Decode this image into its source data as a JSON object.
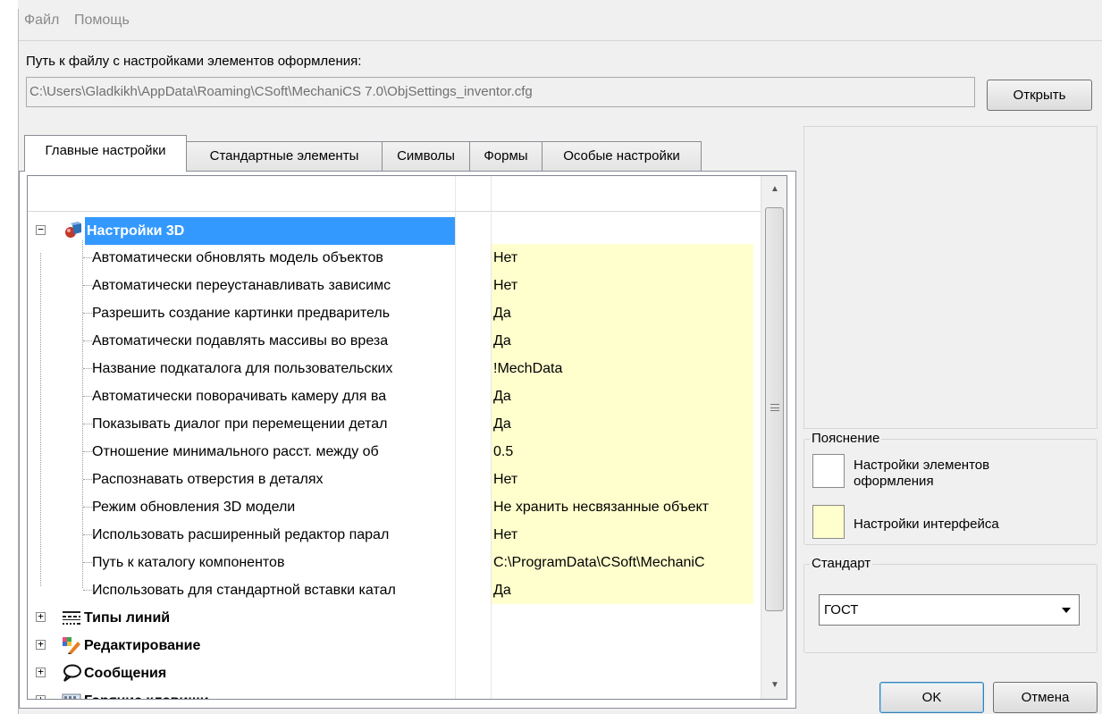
{
  "menu": {
    "file": "Файл",
    "help": "Помощь"
  },
  "path": {
    "label": "Путь к файлу с настройками элементов оформления:",
    "value": "C:\\Users\\Gladkikh\\AppData\\Roaming\\CSoft\\MechaniCS 7.0\\ObjSettings_inventor.cfg",
    "open_button": "Открыть"
  },
  "tabs": [
    {
      "label": "Главные настройки",
      "active": true
    },
    {
      "label": "Стандартные элементы",
      "active": false
    },
    {
      "label": "Символы",
      "active": false
    },
    {
      "label": "Формы",
      "active": false
    },
    {
      "label": "Особые настройки",
      "active": false
    }
  ],
  "tree": {
    "group_3d": {
      "label": "Настройки 3D",
      "expander": "−",
      "icon": "3d-settings-icon",
      "items": [
        {
          "name": "Автоматически обновлять модель объектов",
          "value": "Нет"
        },
        {
          "name": "Автоматически переустанавливать зависимс",
          "value": "Нет"
        },
        {
          "name": "Разрешить создание картинки предваритель",
          "value": "Да"
        },
        {
          "name": "Автоматически подавлять массивы во вреза",
          "value": "Да"
        },
        {
          "name": "Название подкаталога для пользовательских",
          "value": "!MechData"
        },
        {
          "name": "Автоматически поворачивать камеру для ва",
          "value": "Да"
        },
        {
          "name": "Показывать диалог при перемещении детал",
          "value": "Да"
        },
        {
          "name": "Отношение минимального расст. между об",
          "value": "0.5"
        },
        {
          "name": "Распознавать отверстия в деталях",
          "value": "Нет"
        },
        {
          "name": "Режим обновления 3D модели",
          "value": "Не хранить несвязанные объект"
        },
        {
          "name": "Использовать расширенный редактор парал",
          "value": "Нет"
        },
        {
          "name": "Путь к каталогу компонентов",
          "value": "C:\\ProgramData\\CSoft\\MechaniC"
        },
        {
          "name": "Использовать для стандартной вставки катал",
          "value": "Да"
        }
      ]
    },
    "groups": [
      {
        "label": "Типы линий",
        "expander": "+",
        "icon": "line-types-icon"
      },
      {
        "label": "Редактирование",
        "expander": "+",
        "icon": "editing-icon"
      },
      {
        "label": "Сообщения",
        "expander": "+",
        "icon": "speech-bubble-icon"
      },
      {
        "label": "Горячие клавиши",
        "expander": "+",
        "icon": "keyboard-icon"
      }
    ]
  },
  "legend": {
    "title": "Пояснение",
    "item1": "Настройки элементов оформления",
    "item2": "Настройки интерфейса",
    "item1_color": "#ffffff",
    "item2_color": "#ffffcd"
  },
  "standard": {
    "title": "Стандарт",
    "selected": "ГОСТ"
  },
  "buttons": {
    "ok": "OK",
    "cancel": "Отмена"
  },
  "colors": {
    "selection": "#3399ff",
    "interface_cell": "#ffffcd"
  }
}
